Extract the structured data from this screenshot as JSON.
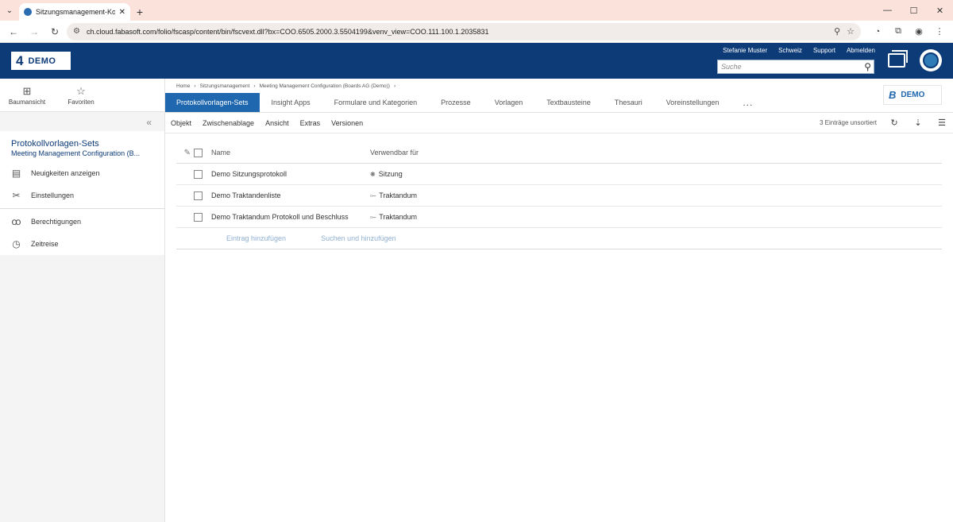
{
  "browser": {
    "tab_title": "Sitzungsmanagement-Konfigura",
    "url": "ch.cloud.fabasoft.com/folio/fscasp/content/bin/fscvext.dll?bx=COO.6505.2000.3.5504199&venv_view=COO.111.100.1.2035831"
  },
  "header": {
    "logo_number": "4",
    "logo_text": "DEMO",
    "links": [
      "Stefanie Muster",
      "Schweiz",
      "Support",
      "Abmelden"
    ],
    "search_placeholder": "Suche"
  },
  "sidebar": {
    "tree_view_label": "Baumansicht",
    "favorites_label": "Favoriten",
    "title": "Protokollvorlagen-Sets",
    "subtitle": "Meeting Management Configuration (B...",
    "items": [
      {
        "label": "Neuigkeiten anzeigen",
        "icon": "news-icon"
      },
      {
        "label": "Einstellungen",
        "icon": "tools-icon"
      },
      {
        "label": "Berechtigungen",
        "icon": "users-icon"
      },
      {
        "label": "Zeitreise",
        "icon": "clock-icon"
      }
    ]
  },
  "breadcrumb": [
    "Home",
    "Sitzungsmanagement",
    "Meeting Management Configuration (Boards AG (Demo))"
  ],
  "tabs": [
    "Protokollvorlagen-Sets",
    "Insight Apps",
    "Formulare und Kategorien",
    "Prozesse",
    "Vorlagen",
    "Textbausteine",
    "Thesauri",
    "Voreinstellungen"
  ],
  "tabs_more": "...",
  "brand": {
    "letter": "B",
    "text": "DEMO"
  },
  "toolbar": {
    "menus": [
      "Objekt",
      "Zwischenablage",
      "Ansicht",
      "Extras",
      "Versionen"
    ],
    "count": "3 Einträge unsortiert"
  },
  "table": {
    "columns": [
      "Name",
      "Verwendbar für"
    ],
    "rows": [
      {
        "name": "Demo Sitzungsprotokoll",
        "usage": "Sitzung",
        "usage_icon": "meeting-icon"
      },
      {
        "name": "Demo Traktandenliste",
        "usage": "Traktandum",
        "usage_icon": "agenda-item-icon"
      },
      {
        "name": "Demo Traktandum Protokoll und Beschluss",
        "usage": "Traktandum",
        "usage_icon": "agenda-item-icon"
      }
    ],
    "add_entry": "Eintrag hinzufügen",
    "search_add": "Suchen und hinzufügen"
  },
  "colors": {
    "header_bg": "#0d3b78",
    "active_tab": "#1f67ae",
    "link": "#8fb0d4"
  }
}
